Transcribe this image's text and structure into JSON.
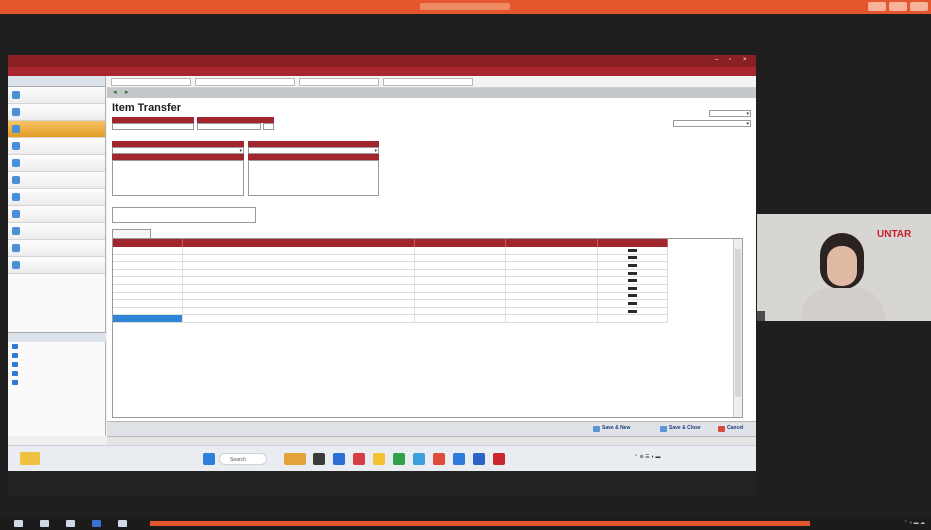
{
  "zoom": {
    "window_title": "",
    "meeting_label": ""
  },
  "app": {
    "window_title": "",
    "menu": ""
  },
  "explorer": {
    "title": "",
    "items": [
      {
        "label": "",
        "icon": "ledger-icon",
        "active": false
      },
      {
        "label": "",
        "icon": "cash-bank-icon",
        "active": false
      },
      {
        "label": "",
        "icon": "inventory-icon",
        "active": true
      },
      {
        "label": "",
        "icon": "sales-icon",
        "active": false
      },
      {
        "label": "",
        "icon": "purchase-icon",
        "active": false
      },
      {
        "label": "",
        "icon": "fixed-asset-icon",
        "active": false
      },
      {
        "label": "",
        "icon": "job-icon",
        "active": false
      },
      {
        "label": "",
        "icon": "mrp-icon",
        "active": false
      },
      {
        "label": "",
        "icon": "project-icon",
        "active": false
      },
      {
        "label": "",
        "icon": "manufacture-icon",
        "active": false
      },
      {
        "label": "",
        "icon": "folder-icon",
        "active": false
      }
    ],
    "links_title": "",
    "links": [
      "",
      "",
      "",
      "",
      ""
    ]
  },
  "form": {
    "title": "Item Transfer",
    "transfer_no_label": "",
    "transfer_no": "",
    "date_label": "",
    "date": "",
    "transfer_from_label": "",
    "transfer_from": "",
    "transfer_to_label": "",
    "transfer_to": "",
    "from_address_label": "",
    "to_address_label": "",
    "description_label": "",
    "description": "",
    "template_label": "",
    "template_value": "",
    "tab_label": ""
  },
  "grid": {
    "columns": [
      "",
      "",
      "",
      "",
      ""
    ],
    "rows": [
      {
        "item": "",
        "description": "",
        "quantity": "",
        "unit": ""
      },
      {
        "item": "",
        "description": "",
        "quantity": "",
        "unit": ""
      },
      {
        "item": "",
        "description": "",
        "quantity": "",
        "unit": ""
      },
      {
        "item": "",
        "description": "",
        "quantity": "",
        "unit": ""
      },
      {
        "item": "",
        "description": "",
        "quantity": "",
        "unit": ""
      },
      {
        "item": "",
        "description": "",
        "quantity": "",
        "unit": ""
      },
      {
        "item": "",
        "description": "",
        "quantity": "",
        "unit": ""
      },
      {
        "item": "",
        "description": "",
        "quantity": "",
        "unit": ""
      },
      {
        "item": "",
        "description": "",
        "quantity": "",
        "unit": ""
      }
    ]
  },
  "actions": {
    "save_new": "Save & New",
    "save_close": "Save & Close",
    "cancel": "Cancel"
  },
  "status": {
    "center": "",
    "right": ""
  },
  "taskbar": {
    "search": "Search",
    "time": "",
    "date": ""
  },
  "webcam": {
    "text_line1": "",
    "text_line2": "",
    "logo": "UNTAR",
    "participant": ""
  },
  "colors": {
    "accent_red": "#a2262d",
    "zoom_orange": "#e4572e",
    "active_item": "#e39b25",
    "selection_blue": "#2f86d6"
  }
}
